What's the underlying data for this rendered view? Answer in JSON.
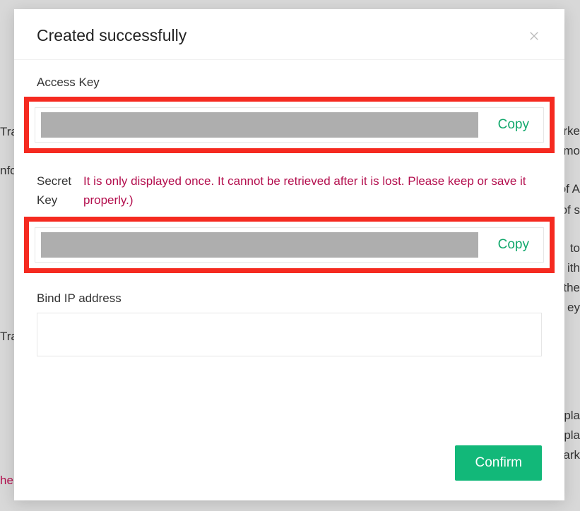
{
  "modal": {
    "title": "Created successfully",
    "access_key": {
      "label": "Access Key",
      "copy_label": "Copy"
    },
    "secret_key": {
      "label": "Secret Key",
      "warning": "It is only displayed once. It cannot be retrieved after it is lost. Please keep or save it properly.)",
      "copy_label": "Copy"
    },
    "bind_ip": {
      "label": "Bind IP address",
      "value": ""
    },
    "confirm_label": "Confirm"
  },
  "background_fragments": {
    "f1": "Tra",
    "f2": "nfo",
    "f3": "Tra",
    "f4": "he",
    "f5": "rke",
    "f6": "mo",
    "f7": "of A",
    "f8": "of s",
    "f9": " to ",
    "f10": "ith",
    "f11": " the",
    "f12": "ey ",
    "f13": "pla",
    "f14": " pla",
    "f15": "ark"
  }
}
